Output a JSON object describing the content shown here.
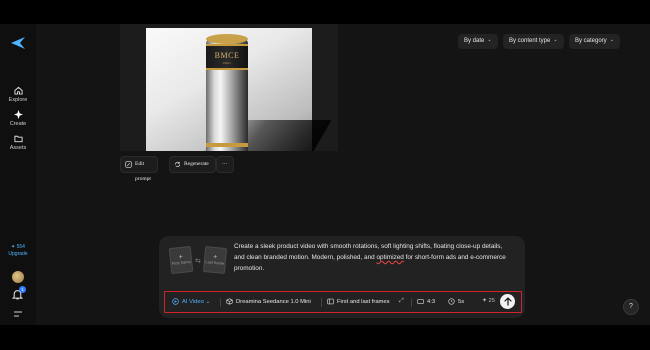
{
  "sidebar": {
    "nav": [
      {
        "label": "Explore",
        "icon": "home-icon"
      },
      {
        "label": "Create",
        "icon": "sparkle-icon"
      },
      {
        "label": "Assets",
        "icon": "folder-icon"
      }
    ],
    "credits_count": "554",
    "credits_label": "Upgrade",
    "notification_count": "1"
  },
  "image": {
    "brand_text": "BMCE",
    "brand_subtext": "PARIS"
  },
  "actions": {
    "edit_prompt": "Edit prompt",
    "regenerate": "Regenerate",
    "more": "···"
  },
  "filters": [
    {
      "label": "By date"
    },
    {
      "label": "By content type"
    },
    {
      "label": "By category"
    }
  ],
  "composer": {
    "first_frame_label": "First frame",
    "last_frame_label": "Last frame",
    "prompt_before": "Create a sleek product video with smooth rotations, soft lighting shifts, floating close-up details, and clean branded motion. Modern, polished, and ",
    "prompt_misspelled": "optimized",
    "prompt_after": " for short-form ads and e-commerce promotion.",
    "toolbar": {
      "mode": "AI Video",
      "model": "Dreamina Seedance 1.0 Mini",
      "frames": "First and last frames",
      "ratio": "4:3",
      "duration": "5s",
      "cost": "25"
    }
  },
  "help_label": "?",
  "colors": {
    "accent": "#4fb3ff",
    "highlight_border": "#d0232b",
    "panel": "#222223"
  }
}
